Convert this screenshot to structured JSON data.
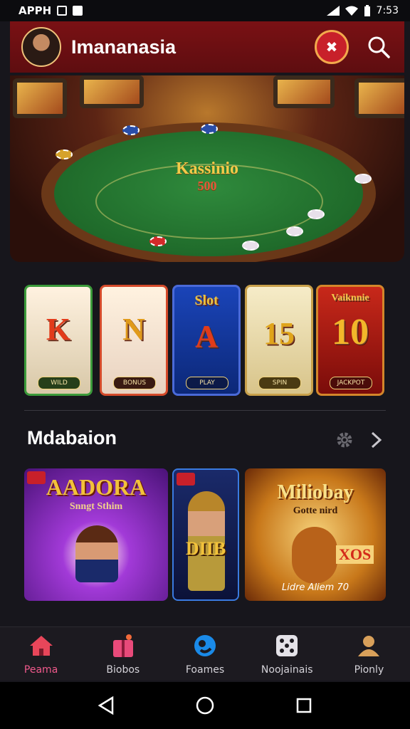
{
  "status_bar": {
    "left_text": "APPH",
    "time": "7:53",
    "icons": [
      "signal-icon",
      "wifi-icon",
      "battery-icon"
    ]
  },
  "header": {
    "title": "Imananasia",
    "avatar_icon": "avatar",
    "promo_icon": "promo-icon",
    "search_icon": "search-icon"
  },
  "hero": {
    "logo": "Kassinio",
    "sub": "500",
    "colors": {
      "felt": "#1f6a2a"
    }
  },
  "slots": [
    {
      "symbol": "K",
      "top_text": "",
      "label": "WILD"
    },
    {
      "symbol": "N",
      "top_text": "",
      "label": "BONUS"
    },
    {
      "symbol": "A",
      "top_text": "Slot",
      "label": "PLAY"
    },
    {
      "symbol": "15",
      "top_text": "",
      "label": "SPIN"
    },
    {
      "symbol": "10",
      "top_text": "Vaiknnie",
      "label": "JACKPOT"
    }
  ],
  "section": {
    "title": "Mdabaion",
    "gear_icon": "gear-icon",
    "next_icon": "chevron-right-icon"
  },
  "games": [
    {
      "title": "AADORA",
      "subtitle": "Snngt Sthim",
      "tag": ""
    },
    {
      "title": "",
      "subtitle": "",
      "tag": "DIIB"
    },
    {
      "title": "Miliobay",
      "subtitle": "Gotte nird",
      "tag": "XOS",
      "footer": "Lidre Aliem 70"
    }
  ],
  "bottom_nav": [
    {
      "label": "Peama",
      "icon": "home-icon",
      "active": true
    },
    {
      "label": "Biobos",
      "icon": "gift-icon",
      "active": false
    },
    {
      "label": "Foames",
      "icon": "games-icon",
      "active": false
    },
    {
      "label": "Noojainais",
      "icon": "dice-icon",
      "active": false
    },
    {
      "label": "Pionly",
      "icon": "profile-icon",
      "active": false
    }
  ],
  "android_nav": [
    "back-icon",
    "home-circle-icon",
    "recents-icon"
  ],
  "colors": {
    "header": "#6b0f12",
    "accent": "#f05a8c",
    "background": "#17161c"
  }
}
